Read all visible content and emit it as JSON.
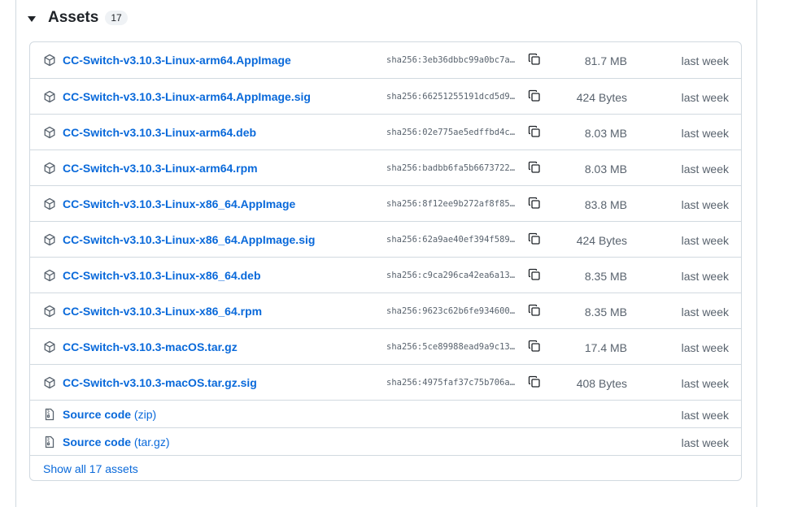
{
  "section": {
    "title": "Assets",
    "count": "17"
  },
  "assets": [
    {
      "name": "CC-Switch-v3.10.3-Linux-arm64.AppImage",
      "sha": "sha256:3eb36dbbc99a0bc7a…",
      "size": "81.7 MB",
      "time": "last week"
    },
    {
      "name": "CC-Switch-v3.10.3-Linux-arm64.AppImage.sig",
      "sha": "sha256:66251255191dcd5d9…",
      "size": "424 Bytes",
      "time": "last week"
    },
    {
      "name": "CC-Switch-v3.10.3-Linux-arm64.deb",
      "sha": "sha256:02e775ae5edffbd4c…",
      "size": "8.03 MB",
      "time": "last week"
    },
    {
      "name": "CC-Switch-v3.10.3-Linux-arm64.rpm",
      "sha": "sha256:badbb6fa5b6673722…",
      "size": "8.03 MB",
      "time": "last week"
    },
    {
      "name": "CC-Switch-v3.10.3-Linux-x86_64.AppImage",
      "sha": "sha256:8f12ee9b272af8f85…",
      "size": "83.8 MB",
      "time": "last week"
    },
    {
      "name": "CC-Switch-v3.10.3-Linux-x86_64.AppImage.sig",
      "sha": "sha256:62a9ae40ef394f589…",
      "size": "424 Bytes",
      "time": "last week"
    },
    {
      "name": "CC-Switch-v3.10.3-Linux-x86_64.deb",
      "sha": "sha256:c9ca296ca42ea6a13…",
      "size": "8.35 MB",
      "time": "last week"
    },
    {
      "name": "CC-Switch-v3.10.3-Linux-x86_64.rpm",
      "sha": "sha256:9623c62b6fe934600…",
      "size": "8.35 MB",
      "time": "last week"
    },
    {
      "name": "CC-Switch-v3.10.3-macOS.tar.gz",
      "sha": "sha256:5ce89988ead9a9c13…",
      "size": "17.4 MB",
      "time": "last week"
    },
    {
      "name": "CC-Switch-v3.10.3-macOS.tar.gz.sig",
      "sha": "sha256:4975faf37c75b706a…",
      "size": "408 Bytes",
      "time": "last week"
    }
  ],
  "sources": [
    {
      "label": "Source code",
      "format": "(zip)",
      "time": "last week"
    },
    {
      "label": "Source code",
      "format": "(tar.gz)",
      "time": "last week"
    }
  ],
  "show_all": "Show all 17 assets",
  "icons": {
    "asset": "package-icon",
    "source": "file-zip-icon",
    "copy": "copy-icon",
    "toggle": "triangle-down-icon"
  },
  "colors": {
    "link": "#0969da",
    "muted": "#59636e",
    "border": "#d1d9e0",
    "text": "#1f2328",
    "badge_bg": "#eff2f5"
  }
}
